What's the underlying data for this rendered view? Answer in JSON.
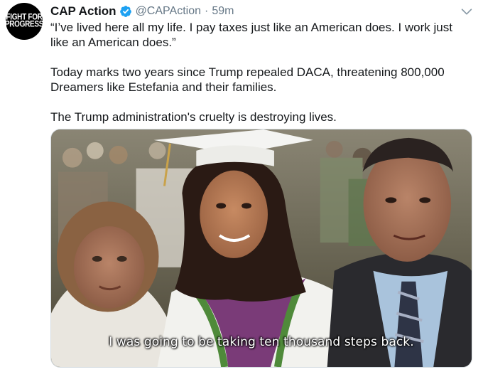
{
  "tweet": {
    "display_name": "CAP Action",
    "handle": "@CAPAction",
    "separator": "·",
    "time": "59m",
    "paragraphs": [
      "“I’ve lived here all my life. I pay taxes just like an American does. I work just like an American does.”",
      "Today marks two years since Trump repealed DACA, threatening 800,000 Dreamers like Estefania and their families.",
      "The Trump administration's cruelty is destroying lives."
    ]
  },
  "avatar": {
    "line1": "FIGHT FOR",
    "line2": "PROGRESS"
  },
  "media": {
    "caption": "I was going to be taking ten thousand steps back."
  },
  "colors": {
    "verified_badge": "#1da1f2",
    "secondary_text": "#657786",
    "primary_text": "#14171a",
    "avatar_bg": "#000000"
  },
  "icons": [
    "verified-badge-icon",
    "chevron-down-icon"
  ]
}
